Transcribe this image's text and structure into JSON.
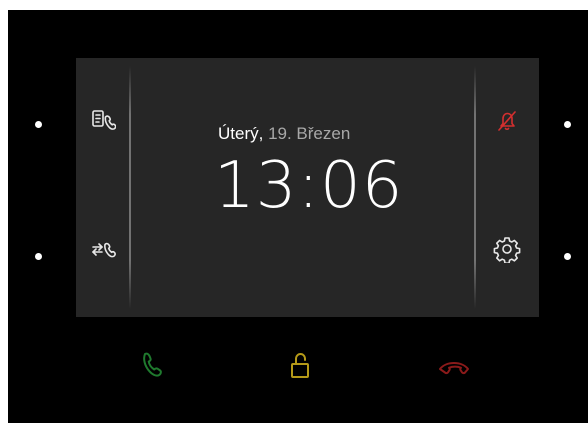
{
  "status": {
    "weekday": "Úterý,",
    "date": "19. Březen",
    "time": "13:06"
  },
  "left_controls": [
    {
      "icon": "call-log-icon"
    },
    {
      "icon": "call-forward-icon"
    }
  ],
  "right_controls": [
    {
      "icon": "bell-muted-icon"
    },
    {
      "icon": "settings-gear-icon"
    }
  ],
  "hardware_buttons": [
    {
      "icon": "phone-answer-icon"
    },
    {
      "icon": "unlock-padlock-icon"
    },
    {
      "icon": "phone-hangup-icon"
    }
  ],
  "colors": {
    "screen": "#262626",
    "bezel": "#000000",
    "answer": "#1f7a2e",
    "unlock": "#b59a18",
    "hangup": "#8b1a1a",
    "mute": "#d32f2f"
  }
}
